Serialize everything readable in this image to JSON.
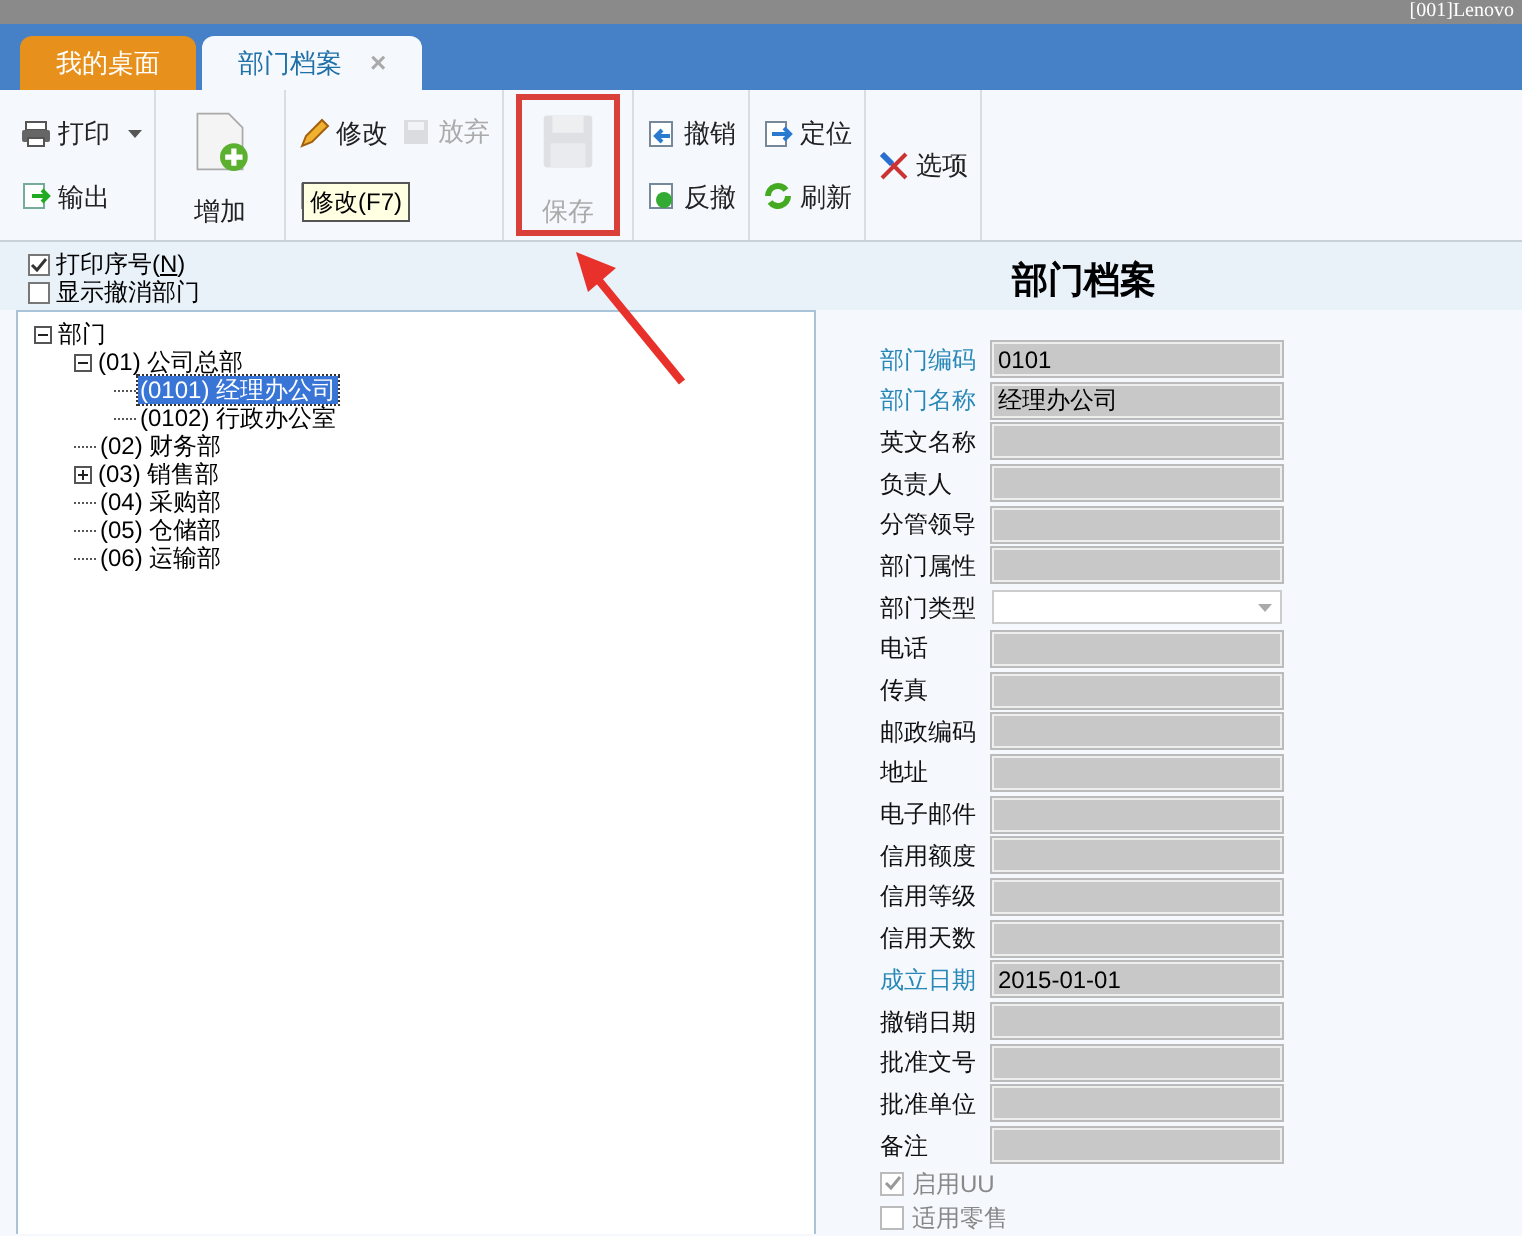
{
  "window": {
    "user": "[001]Lenovo"
  },
  "tabs": [
    {
      "label": "我的桌面",
      "selected": false
    },
    {
      "label": "部门档案",
      "selected": true,
      "close": "×"
    }
  ],
  "toolbar": {
    "groups": [
      {
        "kind": "stack",
        "items": [
          {
            "label": "打印",
            "disabled": false,
            "dropdown": true
          },
          {
            "label": "输出",
            "disabled": false,
            "dropdown": false
          }
        ]
      },
      {
        "kind": "big",
        "items": [
          {
            "label": "增加",
            "disabled": false,
            "highlighted": false
          }
        ]
      },
      {
        "kind": "stack",
        "items": [
          {
            "label": "修改",
            "disabled": false,
            "dropdown": false
          },
          {
            "disabled": false,
            "dropdown": false
          }
        ],
        "side": [
          {
            "label": "放弃",
            "disabled": true
          }
        ]
      },
      {
        "kind": "big",
        "items": [
          {
            "label": "保存",
            "disabled": true,
            "highlighted": true
          }
        ]
      },
      {
        "kind": "stack",
        "items": [
          {
            "label": "撤销",
            "disabled": false,
            "dropdown": false
          },
          {
            "label": "反撤",
            "disabled": false,
            "dropdown": false
          }
        ]
      },
      {
        "kind": "stack",
        "items": [
          {
            "label": "定位",
            "disabled": false,
            "dropdown": false
          },
          {
            "label": "刷新",
            "disabled": false,
            "dropdown": false
          }
        ]
      },
      {
        "kind": "stack",
        "items": [
          {
            "label": "选项",
            "disabled": false,
            "dropdown": false
          }
        ]
      }
    ]
  },
  "tooltip": "修改(F7)",
  "options": [
    {
      "label": "打印序号(",
      "key": "N",
      "suffix": ")",
      "checked": true
    },
    {
      "label": "显示撤消部门",
      "checked": false
    }
  ],
  "title": "部门档案",
  "tree": [
    {
      "label": "部门",
      "expanded": true,
      "selected": false,
      "children": [
        {
          "label": "(01) 公司总部",
          "expanded": true,
          "selected": false,
          "children": [
            {
              "label": "(0101) 经理办公司",
              "selected": true
            },
            {
              "label": "(0102) 行政办公室",
              "selected": false
            }
          ]
        },
        {
          "label": "(02) 财务部",
          "selected": false
        },
        {
          "label": "(03) 销售部",
          "expanded": false,
          "selected": false
        },
        {
          "label": "(04) 采购部",
          "selected": false
        },
        {
          "label": "(05) 仓储部",
          "selected": false
        },
        {
          "label": "(06) 运输部",
          "selected": false
        }
      ]
    }
  ],
  "form": [
    {
      "label": "部门编码",
      "required": true,
      "kind": "text",
      "value": "0101"
    },
    {
      "label": "部门名称",
      "required": true,
      "kind": "text",
      "value": "经理办公司"
    },
    {
      "label": "英文名称",
      "required": false,
      "kind": "text"
    },
    {
      "label": "负责人",
      "required": false,
      "kind": "text"
    },
    {
      "label": "分管领导",
      "required": false,
      "kind": "text"
    },
    {
      "label": "部门属性",
      "required": false,
      "kind": "text"
    },
    {
      "label": "部门类型",
      "required": false,
      "kind": "select"
    },
    {
      "label": "电话",
      "required": false,
      "kind": "text"
    },
    {
      "label": "传真",
      "required": false,
      "kind": "text"
    },
    {
      "label": "邮政编码",
      "required": false,
      "kind": "text"
    },
    {
      "label": "地址",
      "required": false,
      "kind": "text"
    },
    {
      "label": "电子邮件",
      "required": false,
      "kind": "text"
    },
    {
      "label": "信用额度",
      "required": false,
      "kind": "text"
    },
    {
      "label": "信用等级",
      "required": false,
      "kind": "text"
    },
    {
      "label": "信用天数",
      "required": false,
      "kind": "text"
    },
    {
      "label": "成立日期",
      "required": true,
      "kind": "text",
      "value": "2015-01-01"
    },
    {
      "label": "撤销日期",
      "required": false,
      "kind": "text"
    },
    {
      "label": "批准文号",
      "required": false,
      "kind": "text"
    },
    {
      "label": "批准单位",
      "required": false,
      "kind": "text"
    },
    {
      "label": "备注",
      "required": false,
      "kind": "text"
    }
  ],
  "form_checks": [
    {
      "label": "启用UU",
      "checked": true,
      "disabled": true
    },
    {
      "label": "适用零售",
      "checked": false,
      "disabled": true
    }
  ]
}
